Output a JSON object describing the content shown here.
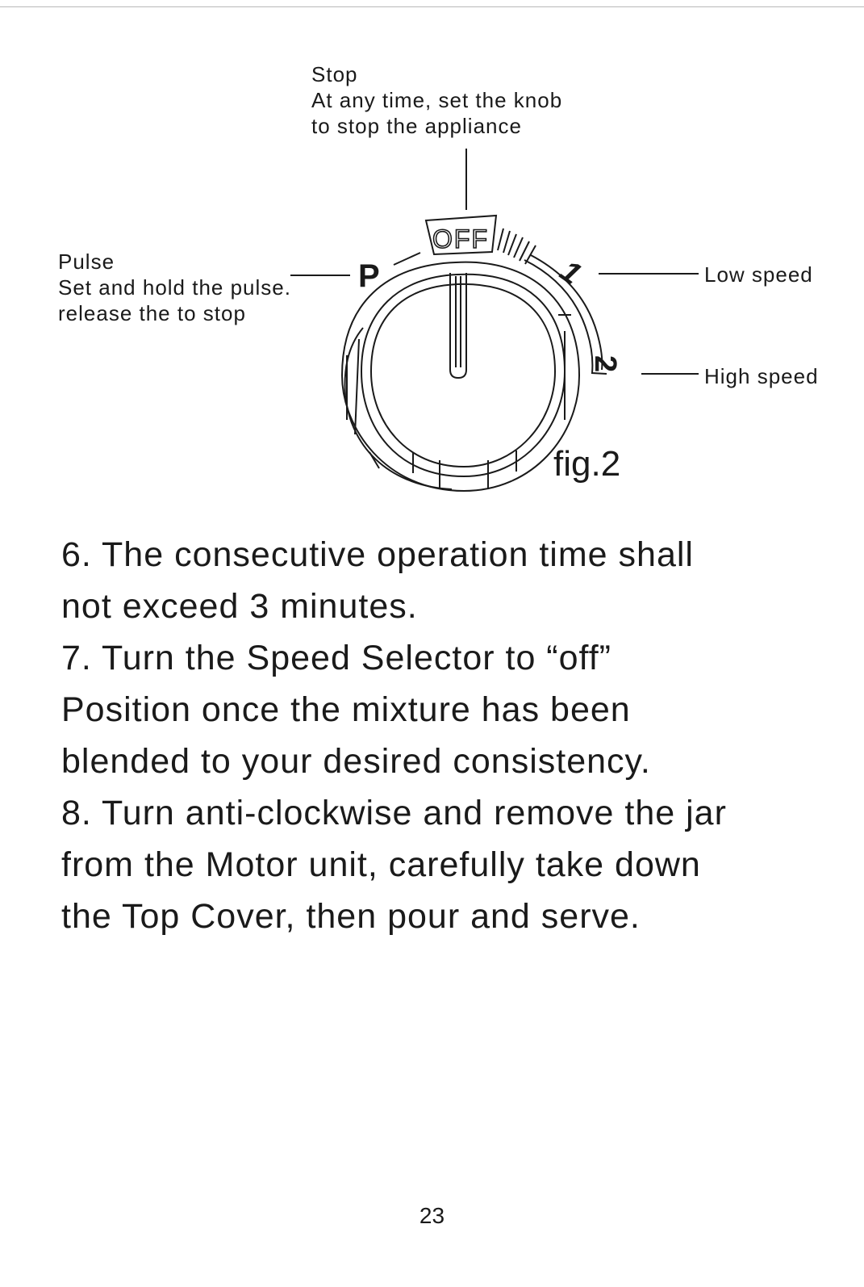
{
  "figure": {
    "stop_label": {
      "title": "Stop",
      "lines": [
        "At any time, set the knob",
        "to stop the appliance"
      ]
    },
    "pulse_label": {
      "title": "Pulse",
      "lines": [
        "Set and hold the pulse.",
        "release the to stop"
      ]
    },
    "low_speed_label": "Low speed",
    "high_speed_label": "High speed",
    "dial_marks": {
      "off": "OFF",
      "pulse": "P",
      "speed_1": "1",
      "speed_2": "2"
    },
    "caption": "fig.2"
  },
  "instructions": [
    "6. The consecutive operation time shall",
    "not exceed 3 minutes.",
    "7. Turn the Speed Selector to “off”",
    "Position once the mixture has been",
    "blended to your desired consistency.",
    "8. Turn anti-clockwise and remove the jar",
    "from the Motor unit, carefully take down",
    "the Top Cover, then pour and serve."
  ],
  "page_number": "23"
}
